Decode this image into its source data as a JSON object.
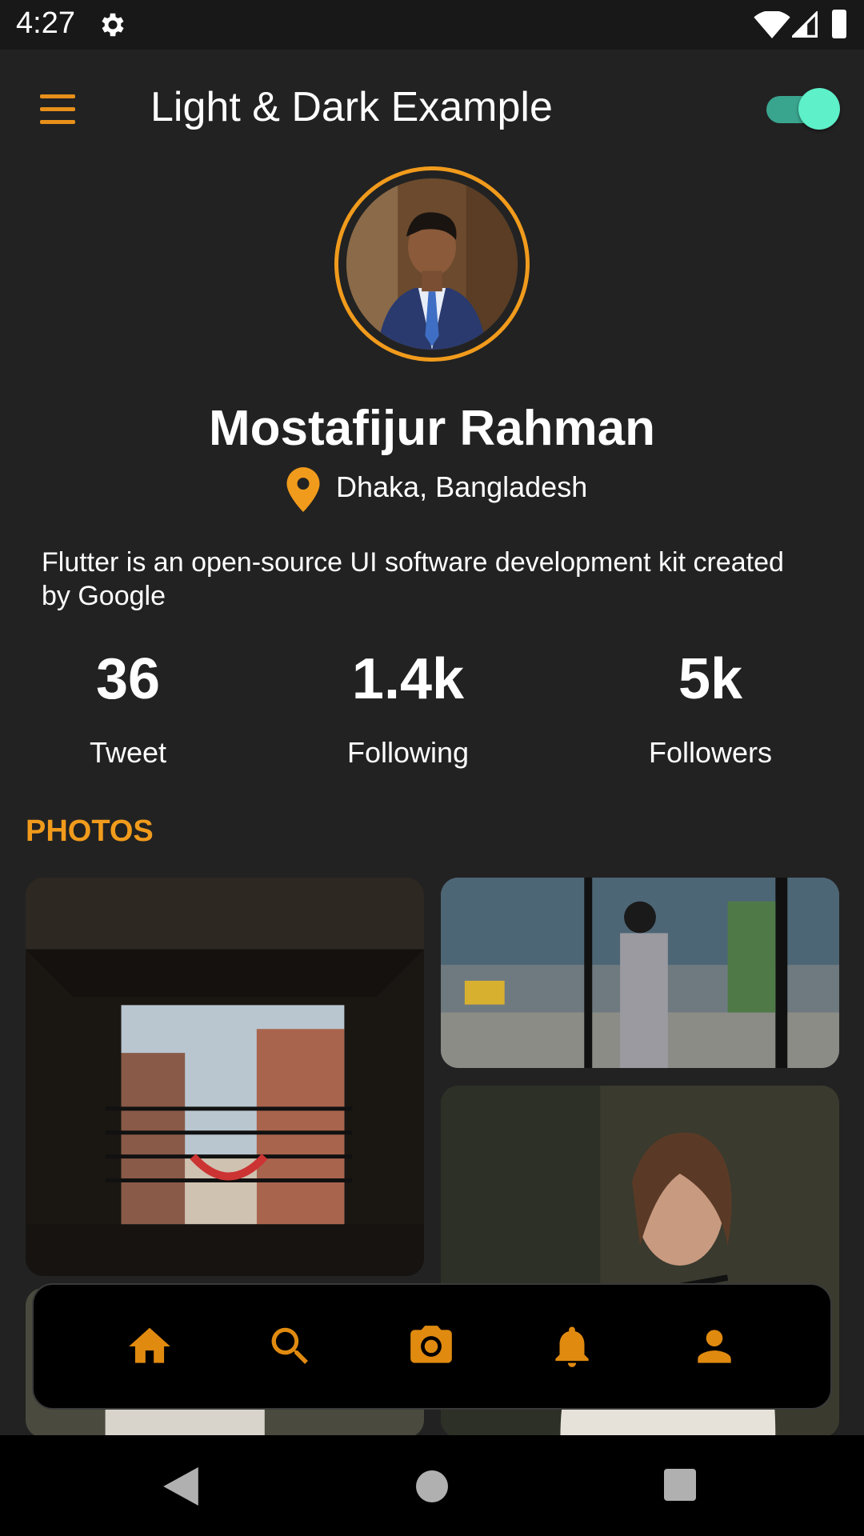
{
  "status_bar": {
    "time": "4:27"
  },
  "app_bar": {
    "title": "Light & Dark Example",
    "dark_mode_enabled": true
  },
  "profile": {
    "name": "Mostafijur Rahman",
    "location": "Dhaka, Bangladesh",
    "bio": "Flutter is an open-source UI software development kit created by Google"
  },
  "stats": [
    {
      "value": "36",
      "label": "Tweet"
    },
    {
      "value": "1.4k",
      "label": "Following"
    },
    {
      "value": "5k",
      "label": "Followers"
    }
  ],
  "photos_section": {
    "heading": "PHOTOS"
  },
  "bottom_nav": {
    "icons": [
      "home-icon",
      "search-icon",
      "camera-icon",
      "bell-icon",
      "person-icon"
    ]
  },
  "colors": {
    "accent": "#f19b1c",
    "background": "#222222",
    "toggle": "#5ef0c8"
  }
}
